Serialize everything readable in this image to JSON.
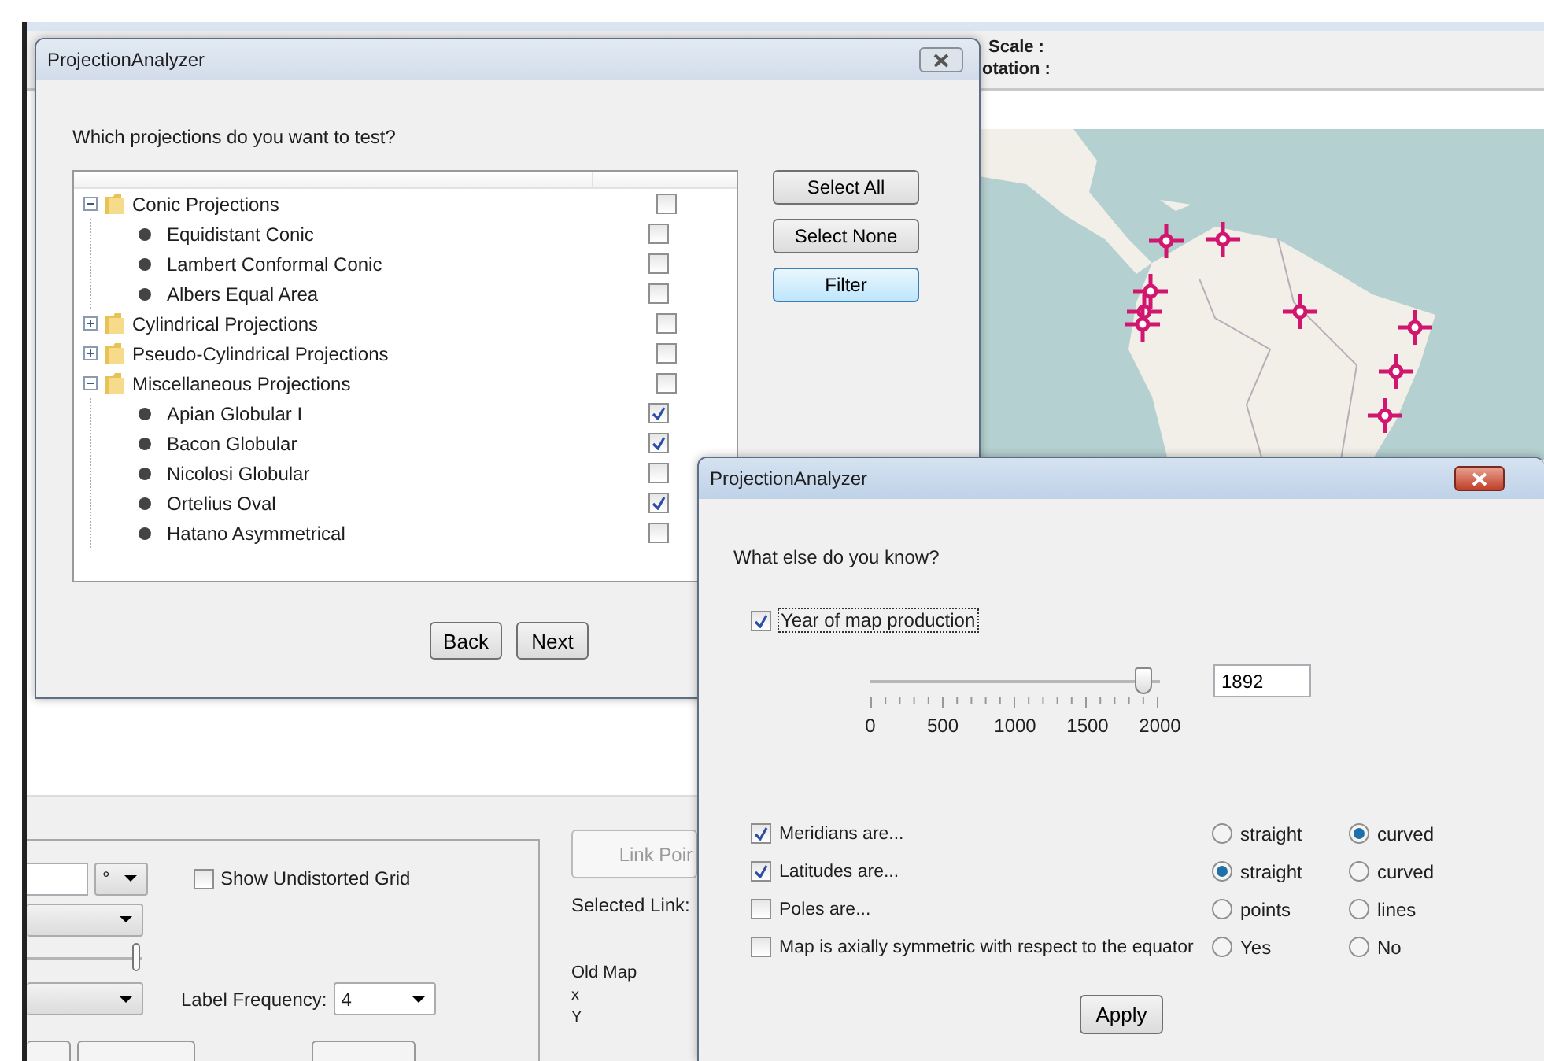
{
  "main_window": {
    "header_labels": [
      "Scale :",
      "otation :"
    ],
    "map": {
      "kind": "picture"
    },
    "settings_panel": {
      "unit_dropdown": "°",
      "grid_option": {
        "label": "Show Undistorted Grid",
        "checked": false
      },
      "slider": {
        "level": 1
      },
      "label_frequency": {
        "label": "Label Frequency:",
        "value": "4"
      }
    },
    "link_panel": {
      "link_button": {
        "label": "Link Poir",
        "disabled": true
      },
      "selected_link_label": "Selected Link:",
      "old_map": {
        "title": "Old Map",
        "x_label": "x",
        "y_label": "Y"
      }
    }
  },
  "projection_dialog": {
    "title": "ProjectionAnalyzer",
    "question": "Which projections do you want to test?",
    "tree": [
      {
        "label": "Conic Projections",
        "expanded": true,
        "checked": false,
        "children": [
          {
            "label": "Equidistant Conic",
            "checked": false
          },
          {
            "label": "Lambert Conformal Conic",
            "checked": false
          },
          {
            "label": "Albers Equal Area",
            "checked": false
          }
        ]
      },
      {
        "label": "Cylindrical Projections",
        "expanded": false,
        "checked": false
      },
      {
        "label": "Pseudo-Cylindrical Projections",
        "expanded": false,
        "checked": false
      },
      {
        "label": "Miscellaneous Projections",
        "expanded": true,
        "checked": false,
        "children": [
          {
            "label": "Apian Globular I",
            "checked": true
          },
          {
            "label": "Bacon Globular",
            "checked": true
          },
          {
            "label": "Nicolosi Globular",
            "checked": false
          },
          {
            "label": "Ortelius Oval",
            "checked": true
          },
          {
            "label": "Hatano Asymmetrical",
            "checked": false
          }
        ]
      }
    ],
    "side_buttons": [
      {
        "label": "Select All",
        "focused": false
      },
      {
        "label": "Select None",
        "focused": false
      },
      {
        "label": "Filter",
        "focused": true
      }
    ],
    "nav_buttons": [
      "Back",
      "Next"
    ]
  },
  "knowledge_dialog": {
    "title": "ProjectionAnalyzer",
    "question": "What else do you know?",
    "year_option": {
      "label": "Year of map production",
      "checked": true
    },
    "year_slider": {
      "level": 0.946,
      "ticks": [
        "0",
        "500",
        "1000",
        "1500",
        "2000"
      ]
    },
    "year_field": {
      "value": "1892"
    },
    "properties": [
      {
        "label": "Meridians are...",
        "checked": true,
        "options": [
          {
            "label": "straight",
            "selected": false
          },
          {
            "label": "curved",
            "selected": true
          }
        ]
      },
      {
        "label": "Latitudes are...",
        "checked": true,
        "options": [
          {
            "label": "straight",
            "selected": true
          },
          {
            "label": "curved",
            "selected": false
          }
        ]
      },
      {
        "label": "Poles are...",
        "checked": false,
        "options": [
          {
            "label": "points",
            "selected": false
          },
          {
            "label": "lines",
            "selected": false
          }
        ]
      },
      {
        "label": "Map is axially symmetric with respect to the equator",
        "checked": false,
        "options": [
          {
            "label": "Yes",
            "selected": false
          },
          {
            "label": "No",
            "selected": false
          }
        ]
      }
    ],
    "apply_button": "Apply"
  }
}
